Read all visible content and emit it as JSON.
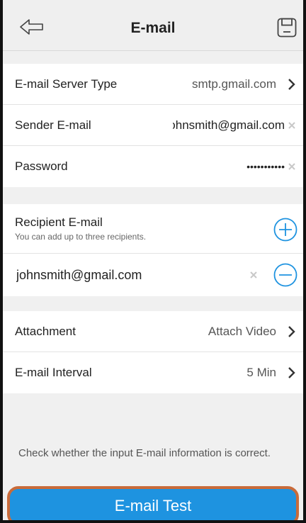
{
  "header": {
    "title": "E-mail",
    "back_icon": "back-arrow-icon",
    "save_icon": "save-icon"
  },
  "server": {
    "server_type_label": "E-mail Server Type",
    "server_type_value": "smtp.gmail.com",
    "sender_label": "Sender E-mail",
    "sender_value": "johnsmith@gmail.com",
    "password_label": "Password",
    "password_value": "•••••••••••"
  },
  "recipients": {
    "label": "Recipient E-mail",
    "hint": "You can add up to three recipients.",
    "items": [
      "johnsmith@gmail.com"
    ]
  },
  "options": {
    "attachment_label": "Attachment",
    "attachment_value": "Attach Video",
    "interval_label": "E-mail Interval",
    "interval_value": "5 Min"
  },
  "footer": {
    "note": "Check whether the input E-mail information is correct.",
    "test_button": "E-mail Test"
  },
  "colors": {
    "accent": "#1e93e0",
    "highlight_border": "#c96b3a"
  }
}
